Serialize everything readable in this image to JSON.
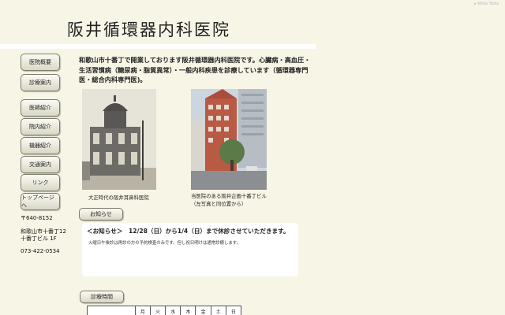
{
  "header": {
    "title": "阪井循環器内科医院",
    "corner_tag": "▸ Ninja Tools"
  },
  "nav": {
    "items": [
      {
        "label": "医院概要"
      },
      {
        "label": "診療案内"
      },
      {
        "label": "医師紹介"
      },
      {
        "label": "院内紹介"
      },
      {
        "label": "機器紹介"
      },
      {
        "label": "交通案内"
      },
      {
        "label": "リンク"
      },
      {
        "label": "トップページへ"
      }
    ]
  },
  "contact": {
    "postal": "〒640-8152",
    "address_line1": "和歌山市十番丁12",
    "address_line2": "十番丁ビル 1F",
    "phone": "073-422-0534"
  },
  "intro": {
    "text": "和歌山市十番丁で開業しております阪井循環器内科医院です。心臓病・高血圧・生活習慣病（糖尿病・脂質異常）・一般内科疾患を診療しています（循環器専門医・総合内科専門医)。"
  },
  "photos": {
    "old_caption": "大正時代の阪井耳鼻科医院",
    "new_caption_line1": "当医院のある阪井企画十番丁ビル",
    "new_caption_line2": "（左写真と同位置から）"
  },
  "notice": {
    "button_label": "お知らせ",
    "headline": "＜お知らせ＞　12/28（日）から1/4（日）まで休診させていただきます。",
    "sub": "火曜日午後診は再診の方の予約検査のみです。但し祝日明けは通常診療します。"
  },
  "schedule": {
    "button_label": "診療時間",
    "days": [
      "月",
      "火",
      "水",
      "木",
      "金",
      "土",
      "日"
    ]
  },
  "colors": {
    "background": "#f7f5e6",
    "button_border": "#7d7b6a"
  }
}
